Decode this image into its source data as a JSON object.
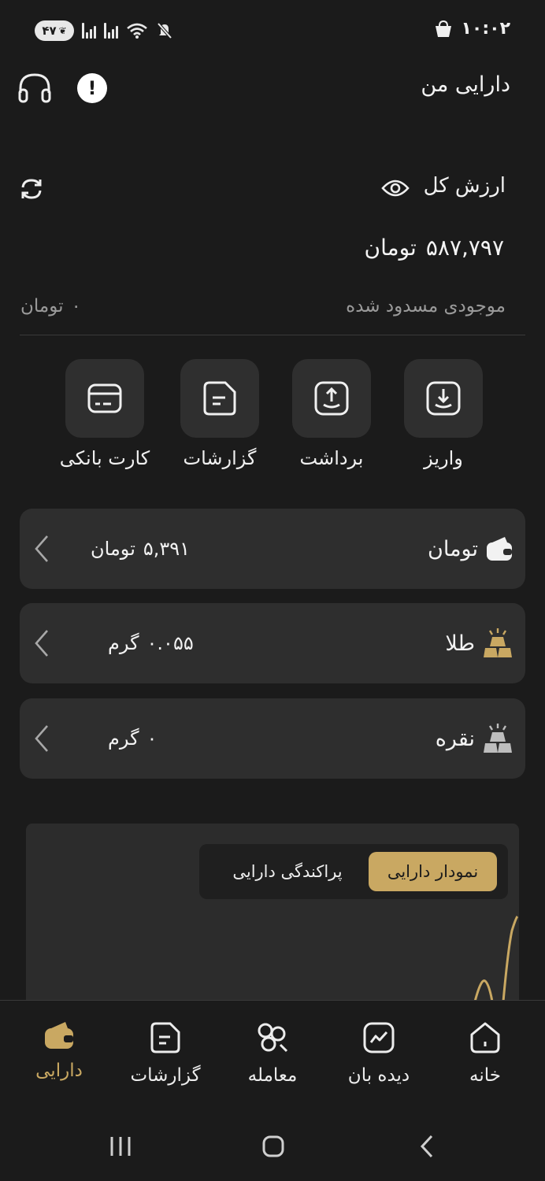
{
  "status_bar": {
    "battery": "۴۷",
    "time": "۱۰:۰۲"
  },
  "header": {
    "title": "دارایی من"
  },
  "summary": {
    "total_label": "ارزش کل",
    "total_amount": "۵۸۷,۷۹۷",
    "total_unit": "تومان",
    "blocked_label": "موجودی مسدود شده",
    "blocked_amount": "۰",
    "blocked_unit": "تومان"
  },
  "actions": [
    {
      "label": "واریز",
      "icon": "deposit-icon"
    },
    {
      "label": "برداشت",
      "icon": "withdraw-icon"
    },
    {
      "label": "گزارشات",
      "icon": "report-icon"
    },
    {
      "label": "کارت بانکی",
      "icon": "bank-card-icon"
    }
  ],
  "assets": [
    {
      "name": "تومان",
      "amount": "۵,۳۹۱",
      "unit": "تومان",
      "icon": "wallet-icon"
    },
    {
      "name": "طلا",
      "amount": "۰.۰۵۵",
      "unit": "گرم",
      "icon": "gold-bars-icon"
    },
    {
      "name": "نقره",
      "amount": "۰",
      "unit": "گرم",
      "icon": "silver-bars-icon"
    }
  ],
  "chart": {
    "tabs": {
      "active": "نمودار دارایی",
      "inactive": "پراکندگی دارایی"
    },
    "colors": {
      "line": "#c9a862",
      "accent": "#c9a862"
    }
  },
  "bottom_nav": [
    {
      "label": "خانه",
      "icon": "home-icon"
    },
    {
      "label": "دیده بان",
      "icon": "watchlist-icon"
    },
    {
      "label": "معامله",
      "icon": "trade-icon"
    },
    {
      "label": "گزارشات",
      "icon": "report-icon"
    },
    {
      "label": "دارایی",
      "icon": "wallet-icon",
      "active": true
    }
  ],
  "colors": {
    "background": "#1b1b1b",
    "card": "#2e2e2e",
    "accent": "#c9a862"
  }
}
